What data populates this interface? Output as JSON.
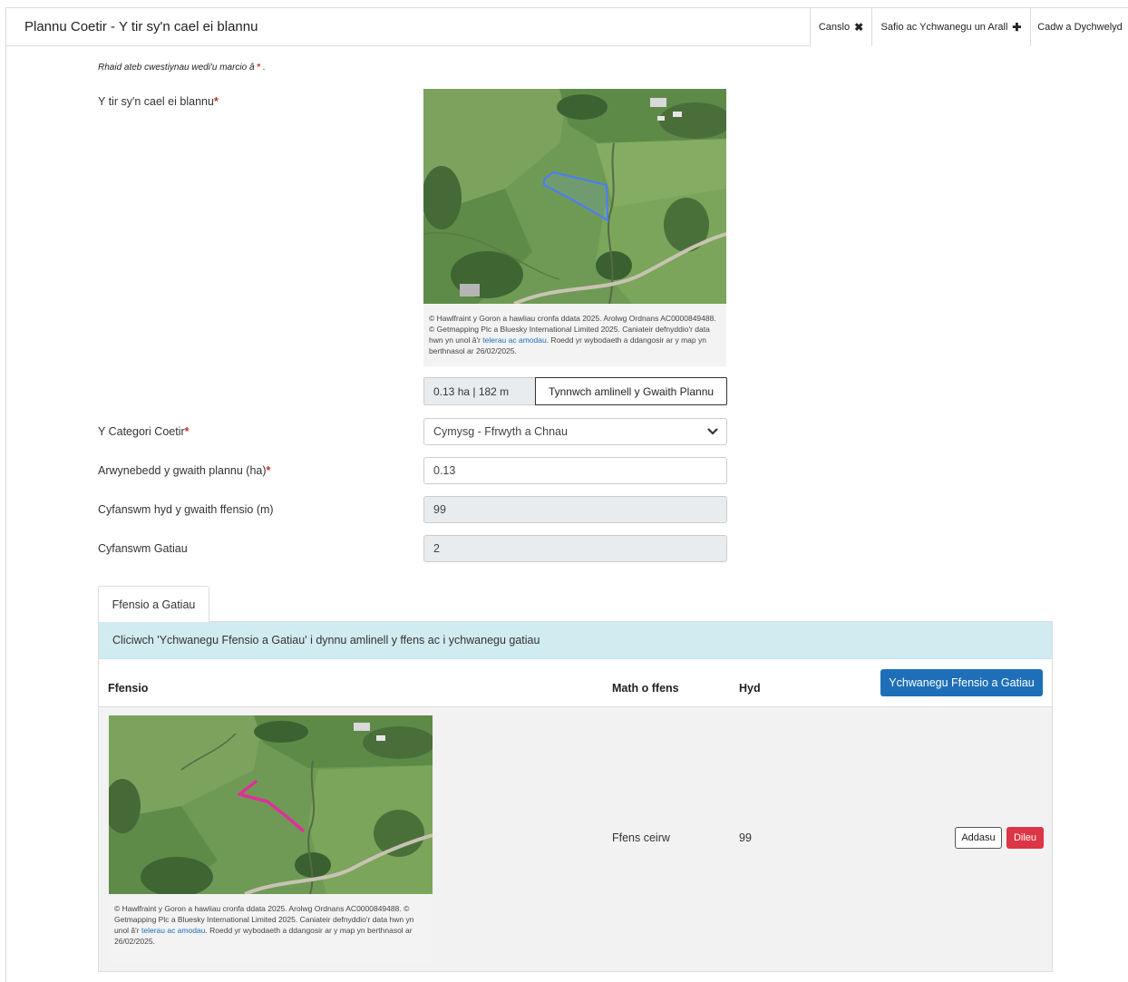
{
  "header": {
    "title": "Plannu Coetir - Y tir sy'n cael ei blannu",
    "cancel_label": "Canslo",
    "cancel_icon": "close-icon",
    "save_add_label": "Safio ac Ychwanegu un Arall",
    "save_add_icon": "plus-icon",
    "save_return_label": "Cadw a Dychwelyd"
  },
  "form": {
    "required_note": "Rhaid ateb cwestiynau wedi'u marcio â",
    "required_star": "*",
    "required_end": ".",
    "land_label": "Y tir sy'n cael ei blannu",
    "map_caption_1": "© Hawlfraint y Goron a hawliau cronfa ddata 2025. Arolwg Ordnans AC0000849488. © Getmapping Plc a Bluesky International Limited 2025. Caniateir defnyddio'r data hwn yn unol â'r ",
    "map_caption_link": "telerau ac amodau",
    "map_caption_2": ". Roedd yr wybodaeth a ddangosir ar y map yn berthnasol ar 26/02/2025.",
    "area_readout": "0.13 ha | 182 m",
    "trace_button": "Tynnwch amlinell y Gwaith Plannu",
    "category_label": "Y Categori Coetir",
    "category_value": "Cymysg - Ffrwyth a Chnau",
    "area_label": "Arwynebedd y gwaith plannu (ha)",
    "area_value": "0.13",
    "fence_total_label": "Cyfanswm hyd y gwaith ffensio (m)",
    "fence_total_value": "99",
    "gates_total_label": "Cyfanswm Gatiau",
    "gates_total_value": "2"
  },
  "fencing": {
    "tab_label": "Ffensio a Gatiau",
    "info_text": "Cliciwch 'Ychwanegu Ffensio a Gatiau' i dynnu amlinell y ffens ac i ychwanegu gatiau",
    "col_fencing": "Ffensio",
    "col_type": "Math o ffens",
    "col_length": "Hyd",
    "add_button": "Ychwanegu Ffensio a Gatiau",
    "rows": [
      {
        "type": "Ffens ceirw",
        "length": "99",
        "edit_label": "Addasu",
        "delete_label": "Dileu"
      }
    ]
  },
  "colors": {
    "accent": "#1f6fb8",
    "danger": "#dc3545",
    "info_bg": "#d1ecf1",
    "plot_outline": "#4a7cff",
    "fence_line": "#e0309a"
  }
}
